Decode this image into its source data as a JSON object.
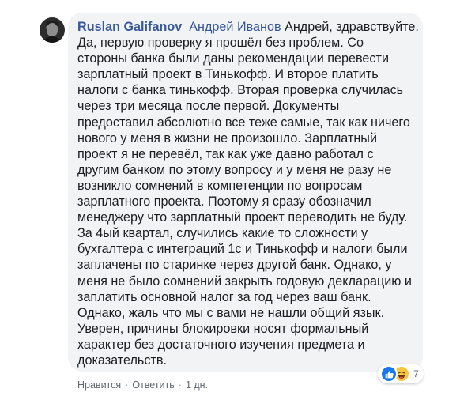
{
  "comment": {
    "author": "Ruslan Galifanov",
    "mention": "Андрей Иванов",
    "lines": [
      "Андрей, здравствуйте.",
      "Да, первую проверку я прошёл без проблем. Со",
      "стороны банка были даны рекомендации перевести",
      "зарплатный проект в Тинькофф. И второе платить",
      "налоги с банка тинькофф. Вторая проверка случилась",
      "через три месяца после первой. Документы",
      "предоставил абсолютно все теже самые, так как ничего",
      "нового у меня в жизни не произошло. Зарплатный",
      "проект я не перевёл, так как уже давно работал с",
      "другим банком по этому вопросу и у меня не разу не",
      "возникло сомнений в компетенции по вопросам",
      "зарплатного проекта. Поэтому я сразу обозначил",
      "менеджеру что зарплатный проект переводить не буду.",
      "За 4ый квартал, случились какие то сложности у",
      "бухгалтера с интеграций 1с и Тинькофф и налоги были",
      "заплачены по старинке через другой банк. Однако, у",
      "меня не было сомнений закрыть годовую декларацию и",
      "заплатить основной налог за год через ваш банк.",
      "Однако, жаль что мы с вами не нашли общий язык.",
      "Уверен, причины блокировки носят формальный",
      "характер без достаточного изучения предмета и",
      "доказательств."
    ],
    "reactions": {
      "icons": [
        "like-icon",
        "haha-icon"
      ],
      "count": "7"
    },
    "actions": {
      "like": "Нравится",
      "separator": "·",
      "reply": "Ответить",
      "time": "1 дн."
    },
    "colors": {
      "bubble": "#f2f3f5",
      "link": "#385898",
      "text": "#1c1e21",
      "meta": "#606770",
      "like": "#1877f2",
      "haha": "#f7c53f"
    }
  }
}
